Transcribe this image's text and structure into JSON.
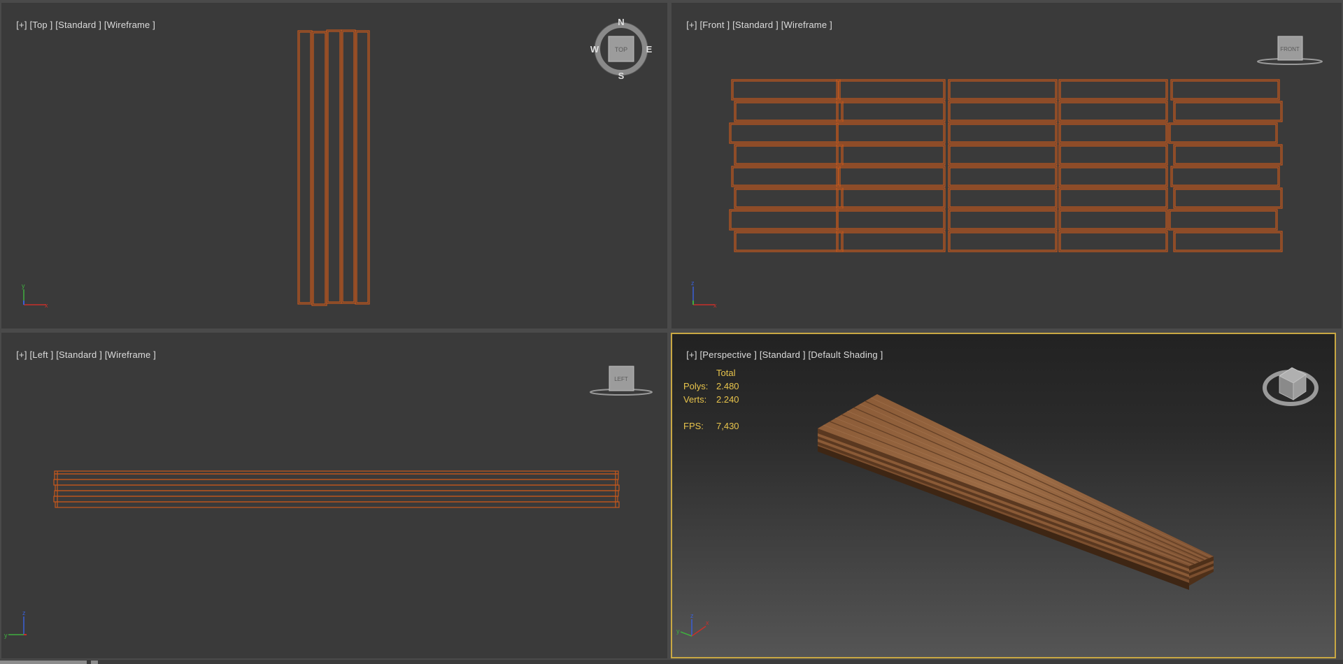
{
  "viewports": {
    "top": {
      "plus": "[+]",
      "view": "[Top ]",
      "standard": "[Standard ]",
      "mode": "[Wireframe ]",
      "compass": {
        "n": "N",
        "s": "S",
        "e": "E",
        "w": "W",
        "cube": "TOP"
      }
    },
    "front": {
      "plus": "[+]",
      "view": "[Front ]",
      "standard": "[Standard ]",
      "mode": "[Wireframe ]",
      "cube": "FRONT"
    },
    "left": {
      "plus": "[+]",
      "view": "[Left ]",
      "standard": "[Standard ]",
      "mode": "[Wireframe ]",
      "cube": "LEFT"
    },
    "perspective": {
      "plus": "[+]",
      "view": "[Perspective ]",
      "standard": "[Standard ]",
      "mode": "[Default Shading ]"
    }
  },
  "stats": {
    "total_label": "Total",
    "polys_label": "Polys:",
    "polys_value": "2.480",
    "verts_label": "Verts:",
    "verts_value": "2.240",
    "fps_label": "FPS:",
    "fps_value": "7,430"
  },
  "axis_labels": {
    "top": {
      "vertical": "y",
      "horizontal": "x"
    },
    "front": {
      "vertical": "z",
      "horizontal": "x"
    },
    "left": {
      "vertical": "z",
      "horizontal": "y"
    },
    "perspective": {
      "vertical": "z",
      "horizontal": "x",
      "depth": "y"
    }
  },
  "colors": {
    "viewport_bg": "#3a3a3a",
    "wireframe": "#c7581c",
    "active_border": "#c9a843",
    "stats_text": "#e8c44c",
    "label_text": "#dcdcdc",
    "axis_x": "#c8302a",
    "axis_y": "#3fae3f",
    "axis_z": "#3a5fd6"
  }
}
